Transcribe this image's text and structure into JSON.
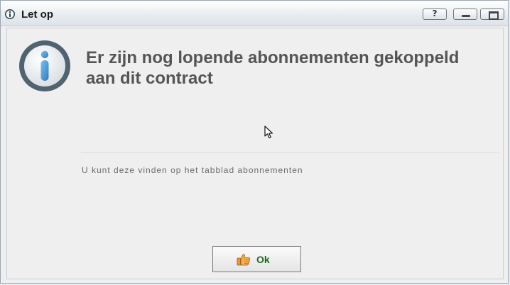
{
  "window": {
    "title": "Let op",
    "title_icon": "info-icon",
    "controls": {
      "help_label": "?",
      "minimize_icon": "minimize-icon",
      "maximize_icon": "maximize-icon"
    }
  },
  "dialog": {
    "icon": "info-icon",
    "headline_line1": "Er zijn nog lopende abonnementen gekoppeld",
    "headline_line2": "aan dit contract",
    "detail": "U kunt deze vinden op het tabblad abonnementen",
    "ok_button": {
      "label": "Ok",
      "icon": "thumbs-up-icon"
    }
  },
  "colors": {
    "headline": "#555555",
    "ok_label": "#1e6b1e",
    "info_ring": "#4f6470",
    "info_fill": "#3d8fd1"
  }
}
